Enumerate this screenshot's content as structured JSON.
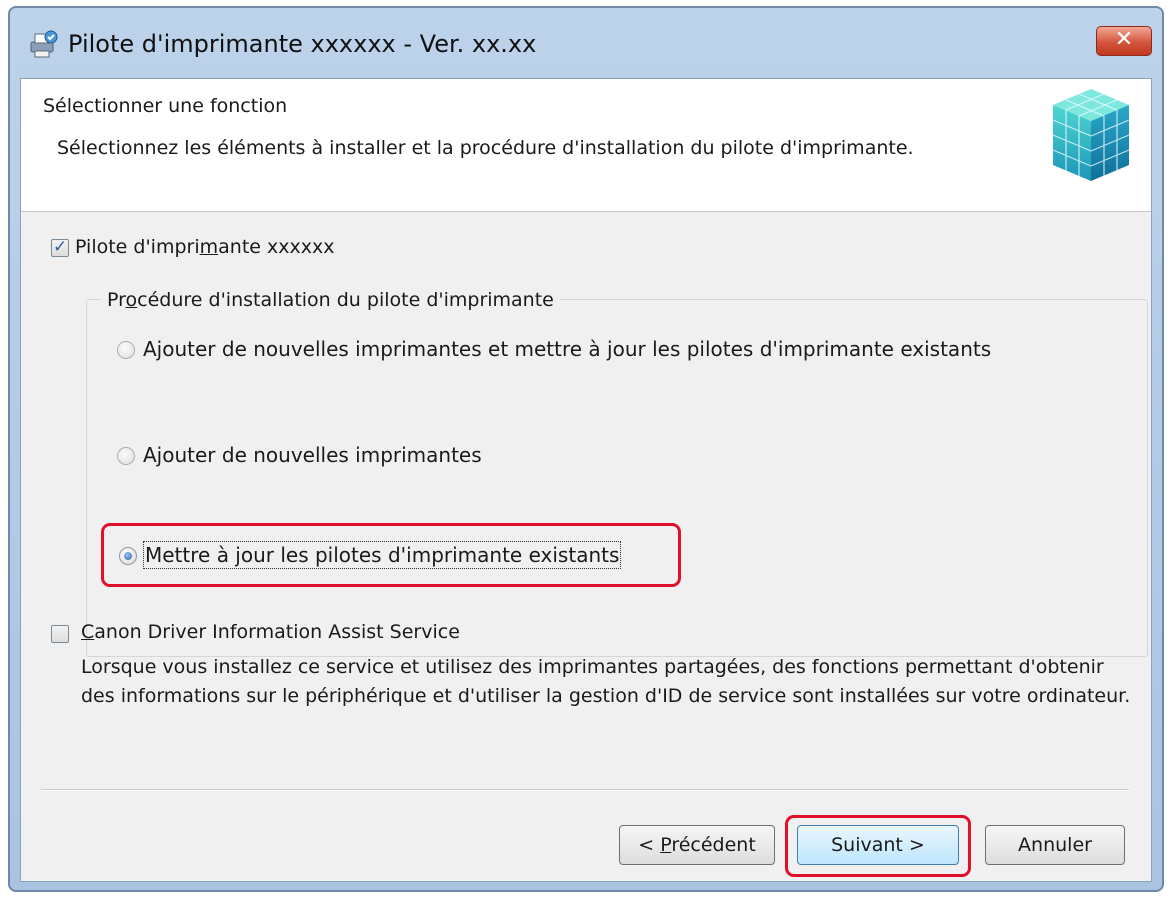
{
  "window": {
    "title": "Pilote d'imprimante xxxxxx - Ver. xx.xx",
    "close_glyph": "✕",
    "icons": [
      "printer-setup-icon",
      "cube-logo-icon"
    ]
  },
  "header": {
    "title": "Sélectionner une fonction",
    "description": "Sélectionnez les éléments à installer et la procédure d'installation du pilote d'imprimante."
  },
  "driver_checkbox": {
    "label_before": "Pilote d'impri",
    "label_underlined": "m",
    "label_after": "ante xxxxxx",
    "checked": true
  },
  "install_group": {
    "legend_before": "Pr",
    "legend_underlined": "o",
    "legend_after": "cédure d'installation du pilote d'imprimante",
    "options": [
      {
        "label": "Ajouter de nouvelles imprimantes et mettre à jour les pilotes d'imprimante existants",
        "selected": false
      },
      {
        "label": "Ajouter de nouvelles imprimantes",
        "selected": false
      },
      {
        "label": "Mettre à jour les pilotes d'imprimante existants",
        "selected": true
      }
    ]
  },
  "service_checkbox": {
    "label_underlined": "C",
    "label_after": "anon Driver Information Assist Service",
    "checked": false,
    "description": "Lorsque vous installez ce service et utilisez des imprimantes partagées, des fonctions permettant d'obtenir des informations sur le périphérique et d'utiliser la gestion d'ID de service sont installées sur votre ordinateur."
  },
  "buttons": {
    "back_prefix": "< ",
    "back_underlined": "P",
    "back_after": "récédent",
    "next": "Suivant >",
    "cancel": "Annuler"
  },
  "colors": {
    "highlight": "#e0102a",
    "accent": "#2b5fa8"
  }
}
